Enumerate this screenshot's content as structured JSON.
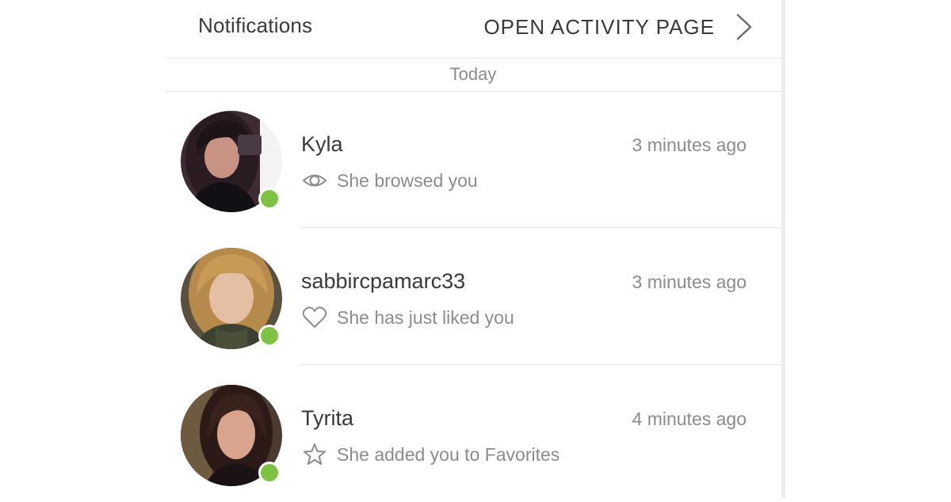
{
  "header": {
    "title": "Notifications",
    "link_label": "OPEN ACTIVITY PAGE",
    "link_icon": "chevron-right-icon"
  },
  "section": {
    "date_label": "Today"
  },
  "colors": {
    "online_indicator": "#7dc242",
    "primary_text": "#3a3a3a",
    "secondary_text": "#8c8c8c",
    "divider": "#e6e6e6"
  },
  "notifications": [
    {
      "name": "Kyla",
      "time": "3 minutes ago",
      "action_icon": "eye-icon",
      "action_text": "She browsed you",
      "online": true
    },
    {
      "name": "sabbircpamarc33",
      "time": "3 minutes ago",
      "action_icon": "heart-icon",
      "action_text": "She has just liked you",
      "online": true
    },
    {
      "name": "Tyrita",
      "time": "4 minutes ago",
      "action_icon": "star-icon",
      "action_text": "She added you to Favorites",
      "online": true
    }
  ]
}
